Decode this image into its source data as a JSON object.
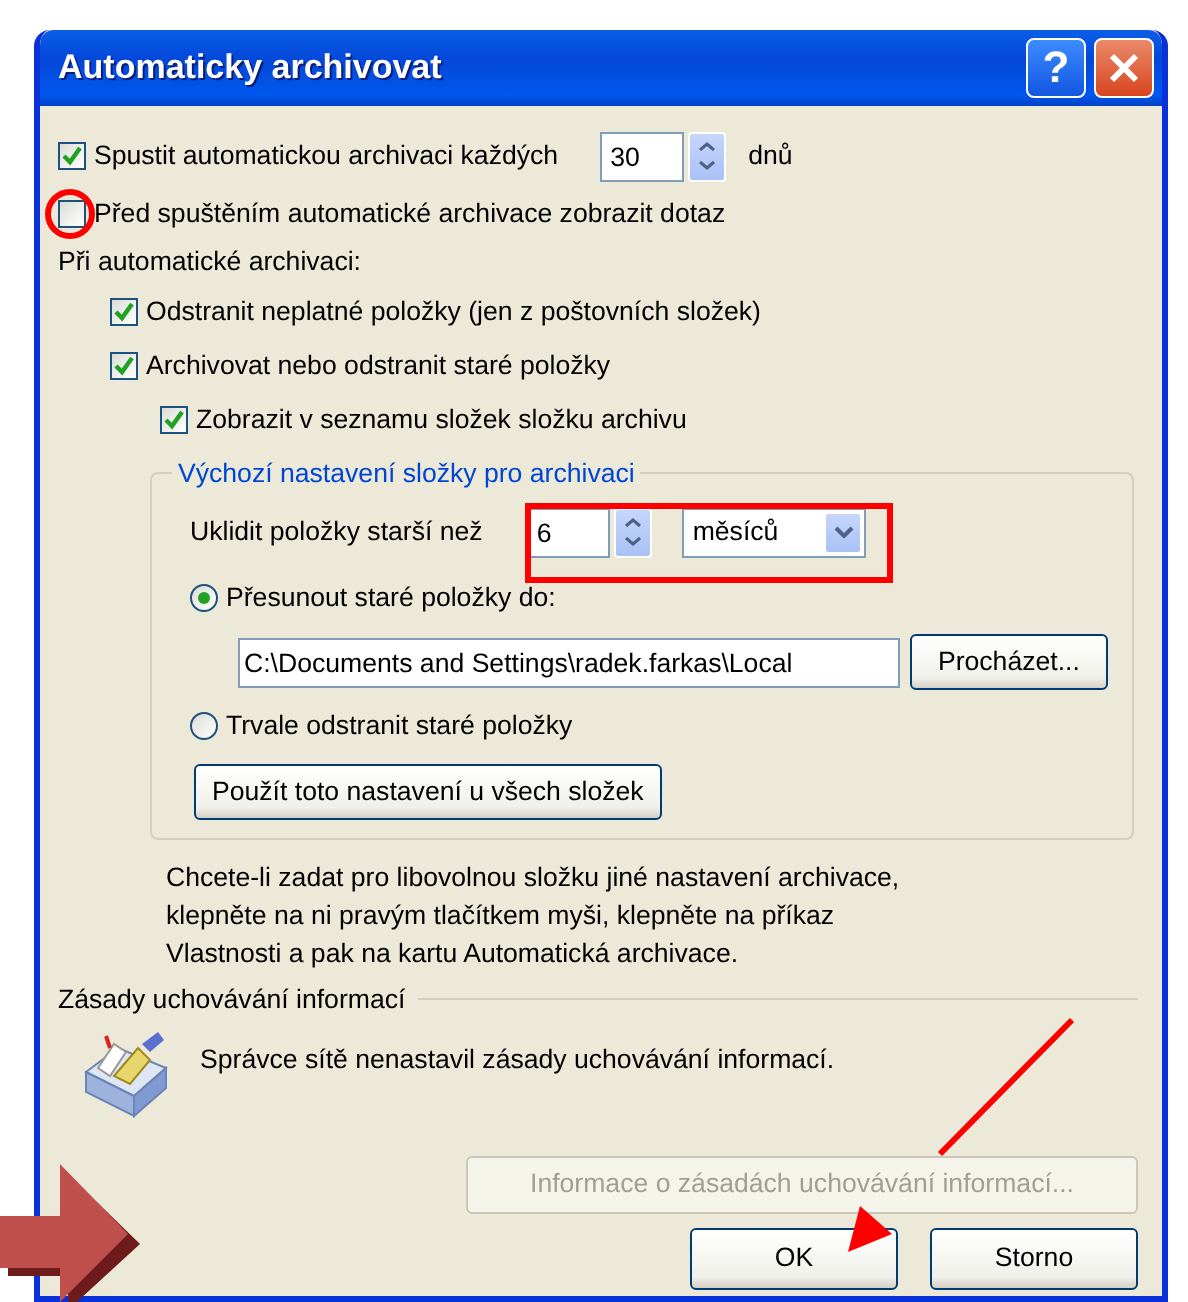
{
  "window": {
    "title": "Automaticky archivovat",
    "help_button": "?"
  },
  "autoarchive": {
    "label": "Spustit automatickou archivaci každých",
    "checked": true,
    "days": "30",
    "unit": "dnů"
  },
  "prompt": {
    "label": "Před spuštěním automatické archivace zobrazit dotaz",
    "checked": false
  },
  "during_label": "Při automatické archivaci:",
  "during_options": [
    {
      "label": "Odstranit neplatné položky (jen z poštovních složek)",
      "checked": true
    },
    {
      "label": "Archivovat nebo odstranit staré položky",
      "checked": true,
      "children": [
        {
          "label": "Zobrazit v seznamu složek složku archivu",
          "checked": true
        }
      ]
    }
  ],
  "default_group": {
    "legend": "Výchozí nastavení složky pro archivaci",
    "clean_label": "Uklidit položky starší než",
    "age": "6",
    "age_unit": "měsíců",
    "actions": [
      {
        "label": "Přesunout staré položky do:",
        "selected": true,
        "path": "C:\\Documents and Settings\\radek.farkas\\Local",
        "browse": "Procházet..."
      },
      {
        "label": "Trvale odstranit staré položky",
        "selected": false
      }
    ],
    "apply_button": "Použít toto nastavení u všech složek"
  },
  "help_text": "Chcete-li zadat pro libovolnou složku jiné nastavení archivace,\nklepněte na ni pravým tlačítkem myši, klepněte na příkaz\nVlastnosti a pak na kartu Automatická archivace.",
  "retention": {
    "title": "Zásady uchovávání informací",
    "message": "Správce sítě nenastavil zásady uchovávání informací.",
    "info_button": {
      "label": "Informace o zásadách uchovávání informací...",
      "disabled": true
    }
  },
  "buttons": [
    "OK",
    "Storno"
  ]
}
